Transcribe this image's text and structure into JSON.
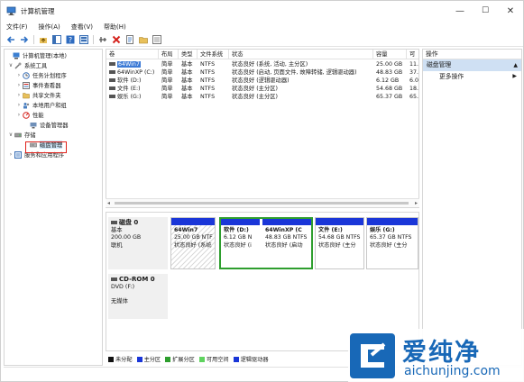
{
  "window": {
    "title": "计算机管理",
    "minimize": "—",
    "maximize": "☐",
    "close": "✕"
  },
  "menu": [
    "文件(F)",
    "操作(A)",
    "查看(V)",
    "帮助(H)"
  ],
  "tree": [
    {
      "label": "计算机管理(本地)",
      "exp": "",
      "icon": "computer-icon",
      "indent": 0
    },
    {
      "label": "系统工具",
      "exp": "∨",
      "icon": "tools-icon",
      "indent": 1
    },
    {
      "label": "任务计划程序",
      "exp": "›",
      "icon": "clock-icon",
      "indent": 2
    },
    {
      "label": "事件查看器",
      "exp": "›",
      "icon": "event-viewer-icon",
      "indent": 2
    },
    {
      "label": "共享文件夹",
      "exp": "›",
      "icon": "shared-folder-icon",
      "indent": 2
    },
    {
      "label": "本地用户和组",
      "exp": "›",
      "icon": "users-icon",
      "indent": 2
    },
    {
      "label": "性能",
      "exp": "›",
      "icon": "performance-icon",
      "indent": 2
    },
    {
      "label": "设备管理器",
      "exp": "",
      "icon": "device-manager-icon",
      "indent": 2
    },
    {
      "label": "存储",
      "exp": "∨",
      "icon": "storage-icon",
      "indent": 1
    },
    {
      "label": "磁盘管理",
      "exp": "",
      "icon": "disk-management-icon",
      "indent": 2
    },
    {
      "label": "服务和应用程序",
      "exp": "›",
      "icon": "services-icon",
      "indent": 1
    }
  ],
  "list": {
    "headers": [
      "卷",
      "布局",
      "类型",
      "文件系统",
      "状态",
      "容量",
      "可"
    ],
    "rows": [
      {
        "name": "64Win7",
        "layout": "简单",
        "type": "基本",
        "fs": "NTFS",
        "status": "状态良好 (系统, 活动, 主分区)",
        "cap": "25.00 GB",
        "free": "11."
      },
      {
        "name": "64WinXP (C:)",
        "layout": "简单",
        "type": "基本",
        "fs": "NTFS",
        "status": "状态良好 (启动, 页面文件, 故障转储, 逻辑驱动器)",
        "cap": "48.83 GB",
        "free": "37."
      },
      {
        "name": "软件 (D:)",
        "layout": "简单",
        "type": "基本",
        "fs": "NTFS",
        "status": "状态良好 (逻辑驱动器)",
        "cap": "6.12 GB",
        "free": "6.0"
      },
      {
        "name": "文件 (E:)",
        "layout": "简单",
        "type": "基本",
        "fs": "NTFS",
        "status": "状态良好 (主分区)",
        "cap": "54.68 GB",
        "free": "18."
      },
      {
        "name": "娱乐 (G:)",
        "layout": "简单",
        "type": "基本",
        "fs": "NTFS",
        "status": "状态良好 (主分区)",
        "cap": "65.37 GB",
        "free": "65."
      }
    ]
  },
  "disk0": {
    "name": "磁盘 0",
    "type": "基本",
    "size": "200.00 GB",
    "state": "联机",
    "partitions": [
      {
        "name": "64Win7",
        "size": "25.00 GB NTF",
        "status": "状态良好 (系统"
      },
      {
        "name": "软件 (D:)",
        "size": "6.12 GB N",
        "status": "状态良好 (i"
      },
      {
        "name": "64WinXP (C",
        "size": "48.83 GB NTFS",
        "status": "状态良好 (启动"
      },
      {
        "name": "文件 (E:)",
        "size": "54.68 GB NTFS",
        "status": "状态良好 (主分"
      },
      {
        "name": "娱乐 (G:)",
        "size": "65.37 GB NTFS",
        "status": "状态良好 (主分"
      }
    ]
  },
  "cdrom": {
    "name": "CD-ROM 0",
    "drive": "DVD (F:)",
    "state": "无媒体"
  },
  "legend": [
    {
      "label": "未分配",
      "color": "#111111"
    },
    {
      "label": "主分区",
      "color": "#1a36d8"
    },
    {
      "label": "扩展分区",
      "color": "#2e9e2e"
    },
    {
      "label": "可用空间",
      "color": "#5fd35f"
    },
    {
      "label": "逻辑驱动器",
      "color": "#1a36d8"
    }
  ],
  "actions": {
    "header": "操作",
    "section": "磁盘管理",
    "items": [
      "更多操作"
    ]
  },
  "watermark": {
    "cn": "爱纯净",
    "en": "aichunjing.com"
  }
}
